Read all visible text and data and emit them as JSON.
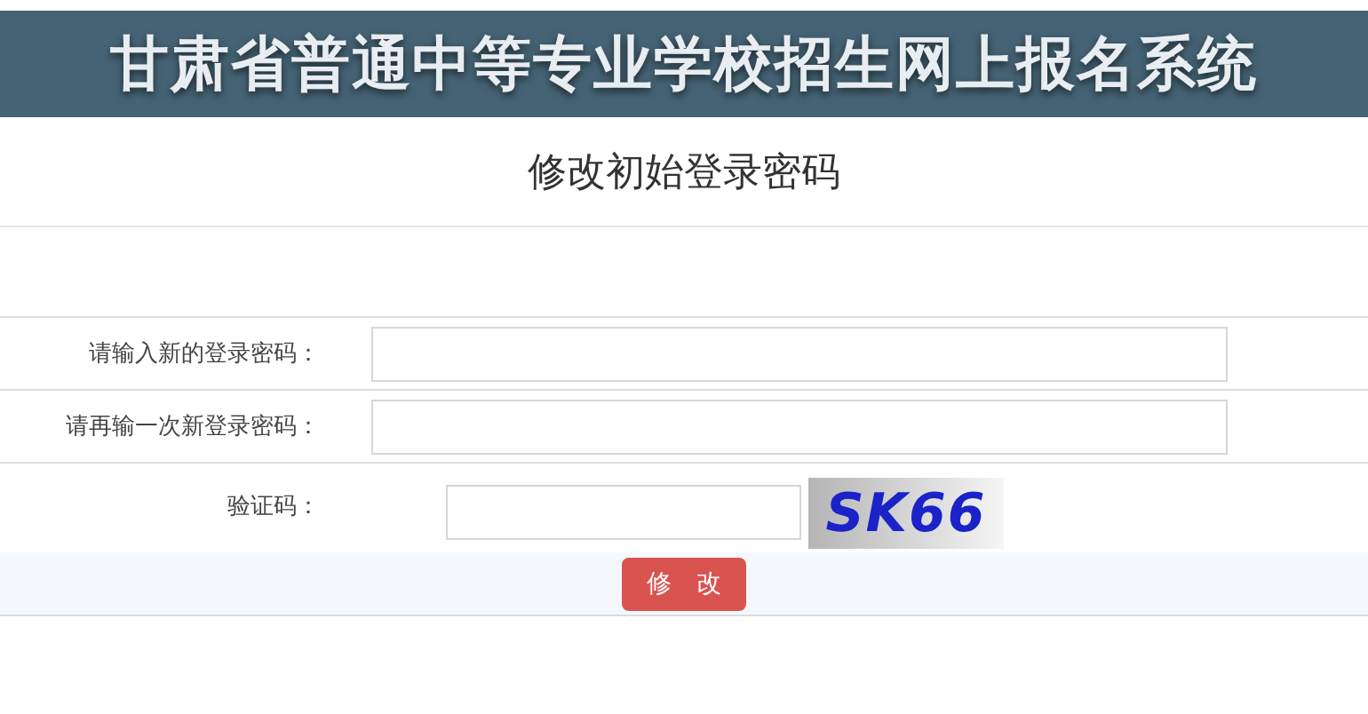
{
  "header": {
    "title": "甘肃省普通中等专业学校招生网上报名系统"
  },
  "page_title": "修改初始登录密码",
  "fields": [
    {
      "label": "请输入新的登录密码：",
      "kind": "password"
    },
    {
      "label": "请再输一次新登录密码：",
      "kind": "password"
    },
    {
      "label": "验证码：",
      "kind": "captcha",
      "captcha": "SK66"
    }
  ],
  "submit_button": "修　改"
}
